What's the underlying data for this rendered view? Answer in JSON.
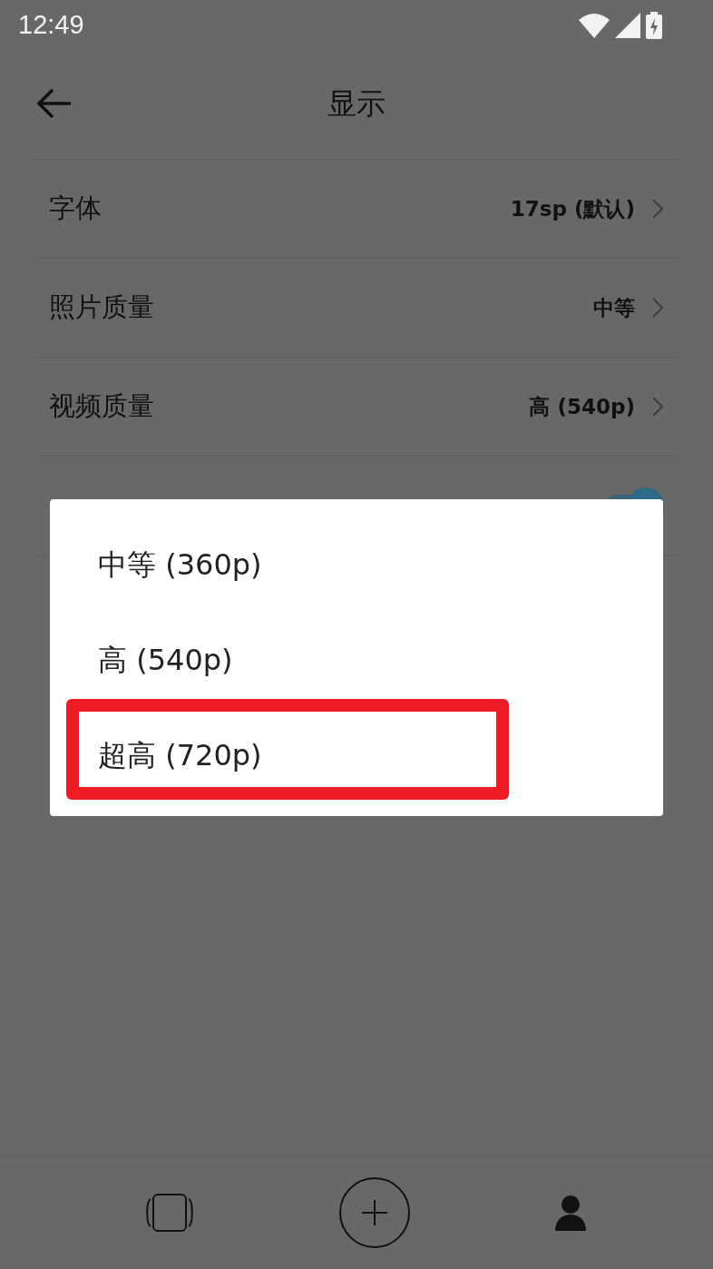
{
  "status_bar": {
    "time": "12:49"
  },
  "header": {
    "title": "显示"
  },
  "settings": [
    {
      "kind": "value",
      "label": "字体",
      "value": "17sp (默认)"
    },
    {
      "kind": "value",
      "label": "照片质量",
      "value": "中等"
    },
    {
      "kind": "value",
      "label": "视频质量",
      "value": "高 (540p)"
    },
    {
      "kind": "toggle",
      "on": true
    }
  ],
  "dialog": {
    "options": [
      {
        "label": "中等 (360p)",
        "highlighted": false
      },
      {
        "label": "高 (540p)",
        "highlighted": false
      },
      {
        "label": "超高 (720p)",
        "highlighted": true
      }
    ]
  },
  "bottom_nav": {
    "items": [
      {
        "kind": "rotate"
      },
      {
        "kind": "add"
      },
      {
        "kind": "profile"
      }
    ]
  }
}
